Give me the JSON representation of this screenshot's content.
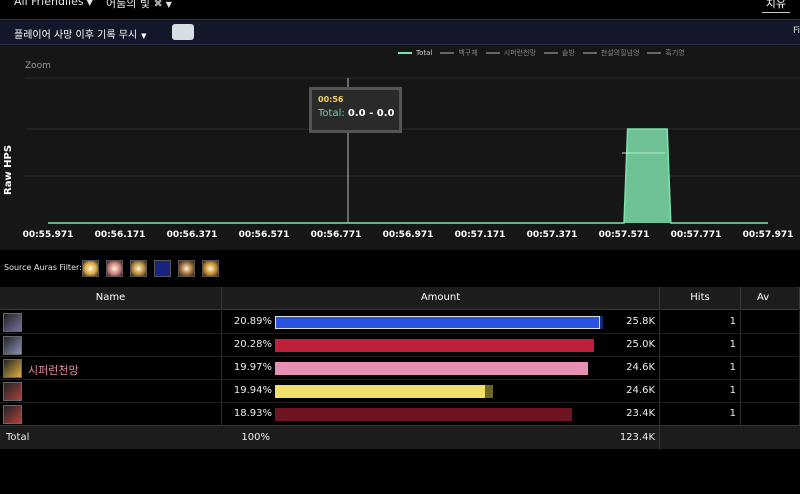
{
  "topnav": {
    "filter_label": "All Friendlies",
    "target_label": "어둠의 빛",
    "right_tab": "치유"
  },
  "toolbar": {
    "death_option": "플레이어 사망 이후 기록 무시",
    "right_text": "Fi"
  },
  "chart": {
    "ylabel": "Raw HPS",
    "zoom_label": "Zoom",
    "legend": [
      {
        "name": "Total",
        "color": "#7ee0ad"
      },
      {
        "name": "백구체",
        "color": "#666666"
      },
      {
        "name": "시퍼런천망",
        "color": "#666666"
      },
      {
        "name": "솔방",
        "color": "#666666"
      },
      {
        "name": "천설의힐넘엉",
        "color": "#666666"
      },
      {
        "name": "흑기영",
        "color": "#666666"
      }
    ],
    "tooltip": {
      "time": "00:56",
      "series": "Total:",
      "value": "0.0 - 0.0"
    }
  },
  "chart_data": {
    "type": "area",
    "title": "",
    "xlabel": "",
    "ylabel": "Raw HPS",
    "x_ticks": [
      "00:55.971",
      "00:56.171",
      "00:56.371",
      "00:56.571",
      "00:56.771",
      "00:56.971",
      "00:57.171",
      "00:57.371",
      "00:57.571",
      "00:57.771",
      "00:57.971"
    ],
    "series": [
      {
        "name": "Total",
        "color": "#7ee0ad",
        "x": [
          "00:55.971",
          "00:57.571",
          "00:57.581",
          "00:57.691",
          "00:57.701",
          "00:57.971"
        ],
        "values": [
          0,
          0,
          1,
          1,
          0,
          0
        ]
      }
    ],
    "grid": true,
    "legend_position": "top-right"
  },
  "auras": {
    "label": "Source Auras Filter:",
    "icons": [
      {
        "name": "holy-burst-aura-icon",
        "color": "#d8a640"
      },
      {
        "name": "radiant-aura-icon",
        "color": "#c97a7a"
      },
      {
        "name": "golden-light-aura-icon",
        "color": "#b88a3a"
      },
      {
        "name": "night-sky-aura-icon",
        "color": "#1a237e"
      },
      {
        "name": "paladin-aura-icon",
        "color": "#a06a3a"
      },
      {
        "name": "flame-aura-icon",
        "color": "#c2892a"
      }
    ]
  },
  "table": {
    "headers": [
      "Name",
      "Amount",
      "Hits",
      "Av"
    ],
    "rows": [
      {
        "name": "",
        "percent": "20.89%",
        "fraction": 1.0,
        "amount": "25.8K",
        "hits": "1",
        "color": "#2a52e0",
        "tail": "#1a2a70",
        "avatar": "#7a6fa0"
      },
      {
        "name": "",
        "percent": "20.28%",
        "fraction": 0.972,
        "amount": "25.0K",
        "hits": "1",
        "color": "#c0213a",
        "tail": "#c0213a",
        "avatar": "#8a92b8"
      },
      {
        "name": "시퍼런천망",
        "percent": "19.97%",
        "fraction": 0.954,
        "amount": "24.6K",
        "hits": "1",
        "color": "#e890b4",
        "tail": "#e890b4",
        "avatar": "#e0b040"
      },
      {
        "name": "",
        "percent": "19.94%",
        "fraction": 0.665,
        "amount": "24.6K",
        "hits": "1",
        "color": "#f0e06a",
        "tail": "#6d6627",
        "avatar": "#a84040"
      },
      {
        "name": "",
        "percent": "18.93%",
        "fraction": 0.907,
        "amount": "23.4K",
        "hits": "1",
        "color": "#701424",
        "tail": "#701424",
        "avatar": "#b04040"
      }
    ],
    "total": {
      "label": "Total",
      "percent": "100%",
      "amount": "123.4K"
    }
  }
}
